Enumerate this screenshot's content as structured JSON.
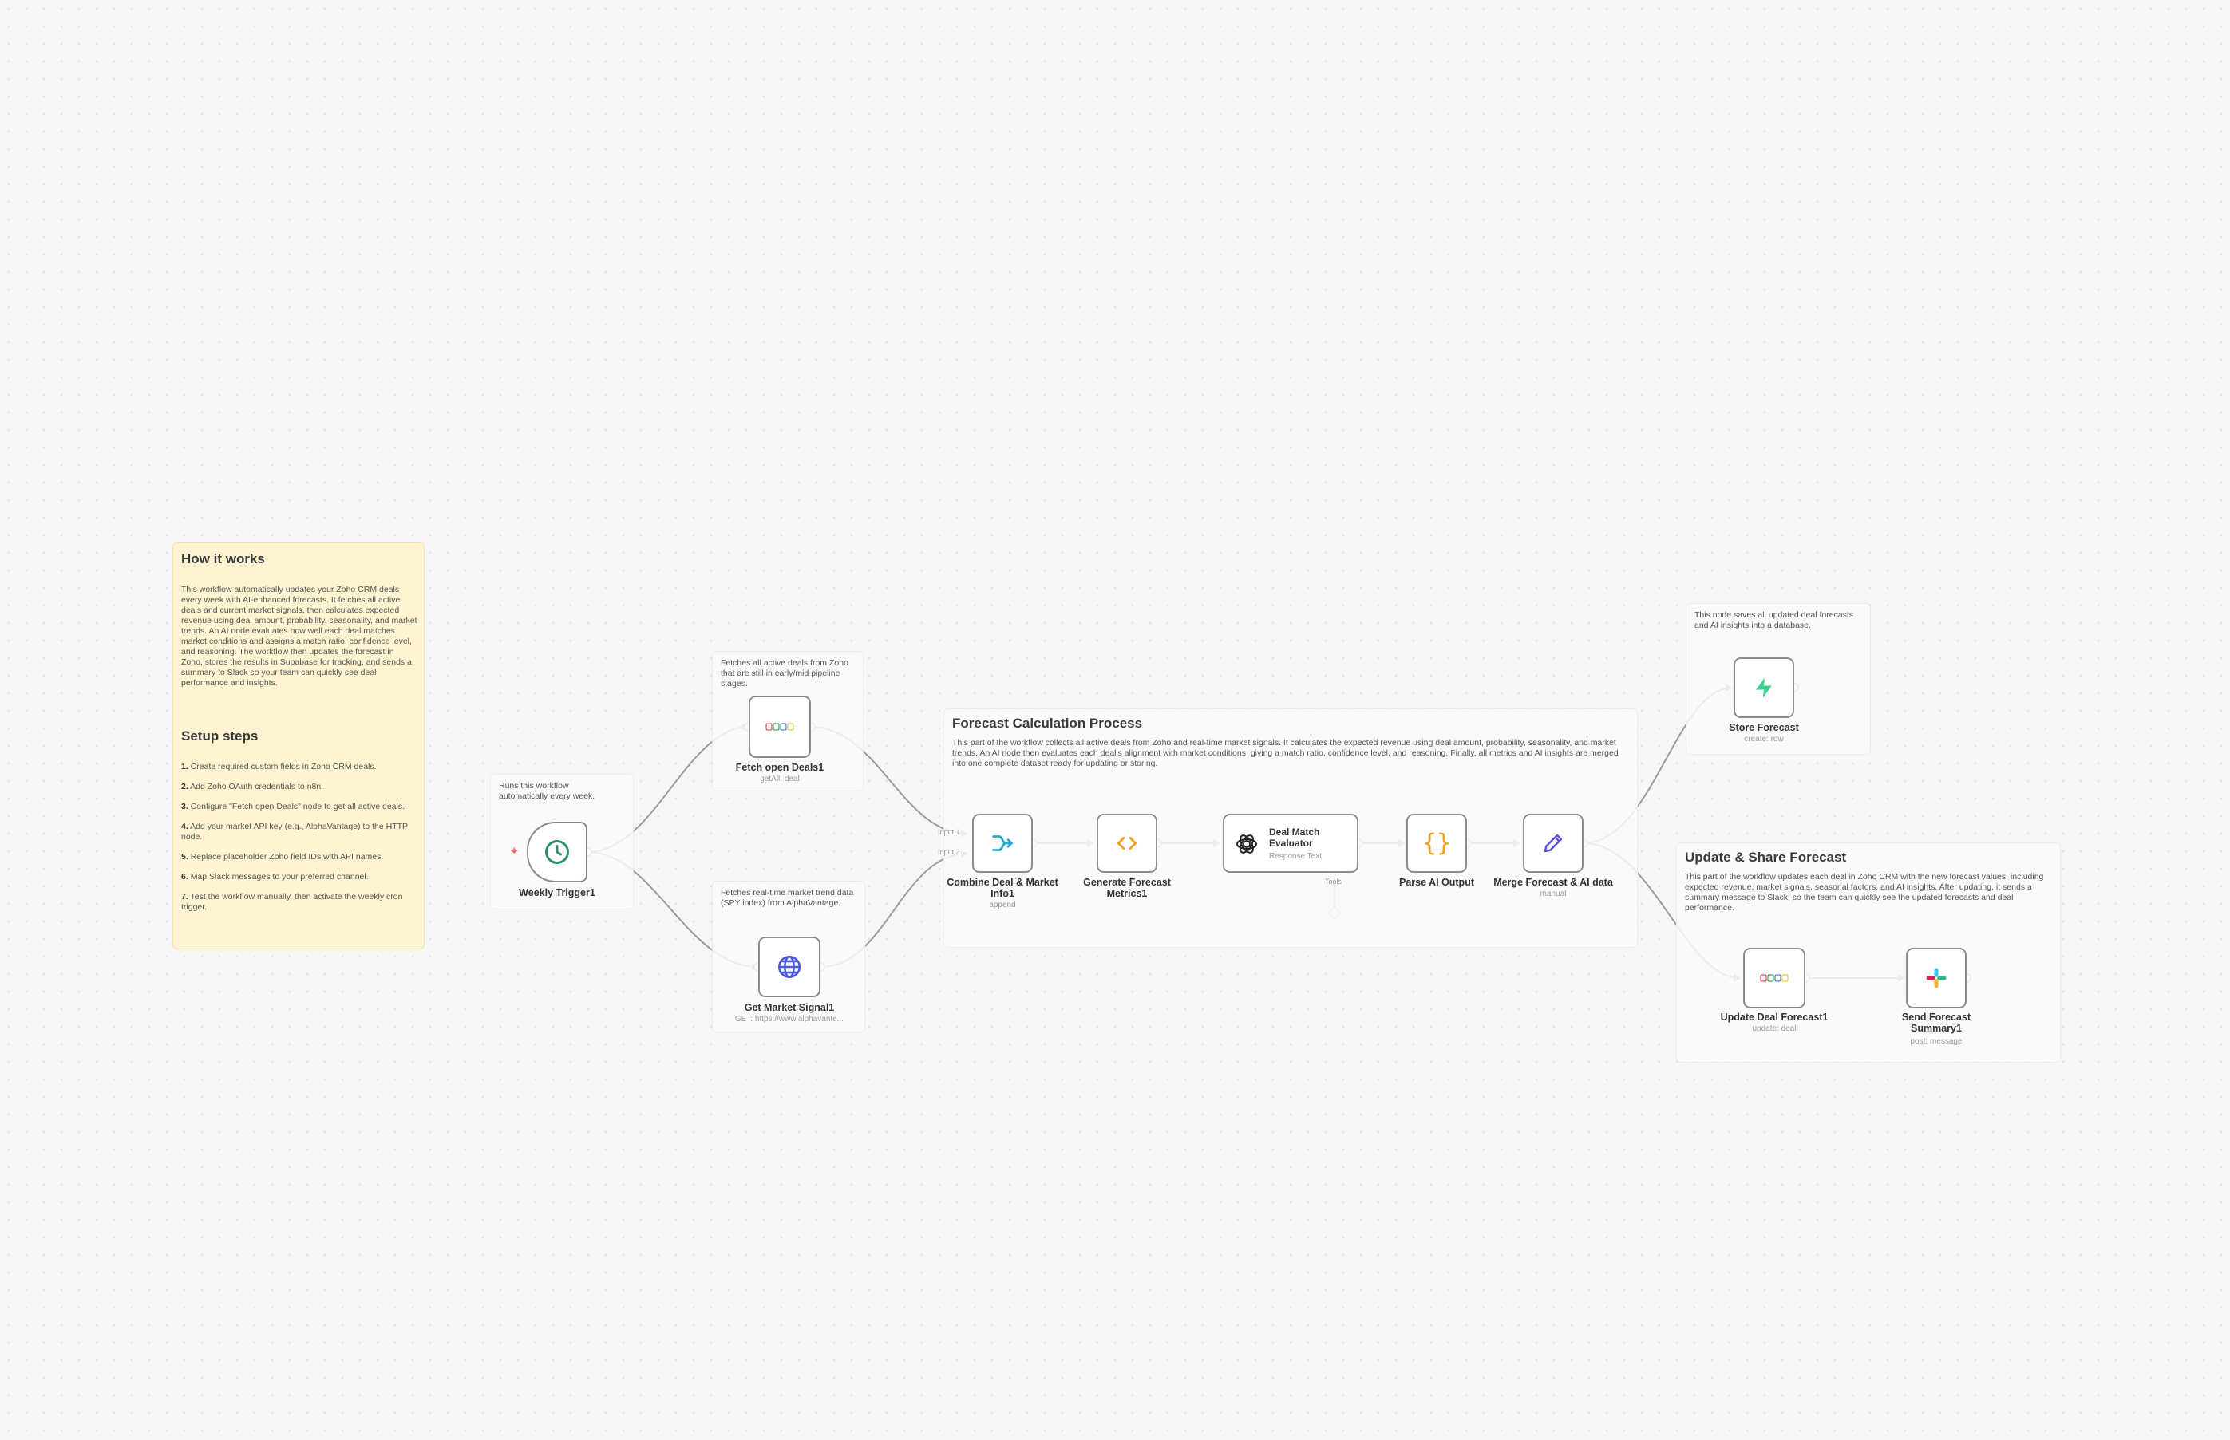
{
  "notes": {
    "how_it_works": {
      "title": "How it works",
      "body": "This workflow automatically updates your Zoho CRM deals every week with AI-enhanced forecasts. It fetches all active deals and current market signals, then calculates expected revenue using deal amount, probability, seasonality, and market trends. An AI node evaluates how well each deal matches market conditions and assigns a match ratio, confidence level, and reasoning. The workflow then updates the forecast in Zoho, stores the results in Supabase for tracking, and sends a summary to Slack so your team can quickly see deal performance and insights."
    },
    "setup": {
      "title": "Setup steps",
      "steps": [
        {
          "num": "1.",
          "text": "Create required custom fields in Zoho CRM deals."
        },
        {
          "num": "2.",
          "text": "Add Zoho OAuth credentials to n8n."
        },
        {
          "num": "3.",
          "text": "Configure \"Fetch open Deals\" node to get all active deals."
        },
        {
          "num": "4.",
          "text": "Add your market API key (e.g., AlphaVantage) to the HTTP node."
        },
        {
          "num": "5.",
          "text": "Replace placeholder Zoho field IDs with API names."
        },
        {
          "num": "6.",
          "text": "Map Slack messages to your preferred channel."
        },
        {
          "num": "7.",
          "text": "Test the workflow manually, then activate the weekly cron trigger."
        }
      ]
    },
    "trigger_note": "Runs this workflow automatically every week.",
    "fetch_note": "Fetches all active deals from Zoho that are still in early/mid pipeline stages.",
    "market_note": "Fetches real-time market trend data (SPY index) from AlphaVantage.",
    "forecast_section": {
      "title": "Forecast Calculation Process",
      "body": "This part of the workflow collects all active deals from Zoho and real-time market signals. It calculates the expected revenue using deal amount, probability, seasonality, and market trends. An AI node then evaluates each deal's alignment with market conditions, giving a match ratio, confidence level, and reasoning. Finally, all metrics and AI insights are merged into one complete dataset ready for updating or storing."
    },
    "store_note": "This node saves all updated deal forecasts and AI insights into a database.",
    "share_section": {
      "title": "Update & Share Forecast",
      "body": "This part of the workflow updates each deal in Zoho CRM with the new forecast values, including expected revenue, market signals, seasonal factors, and AI insights. After updating, it sends a summary message to Slack, so the team can quickly see the updated forecasts and deal performance."
    }
  },
  "nodes": {
    "weekly_trigger": {
      "label": "Weekly Trigger1",
      "icon": "clock-icon"
    },
    "fetch_deals": {
      "label": "Fetch open Deals1",
      "sub": "getAll: deal",
      "icon": "zoho-icon"
    },
    "market_signal": {
      "label": "Get Market Signal1",
      "sub": "GET: https://www.alphavante...",
      "icon": "globe-icon"
    },
    "combine": {
      "label": "Combine Deal & Market Info1",
      "sub": "append",
      "port1": "Input 1",
      "port2": "Input 2",
      "icon": "merge-icon"
    },
    "generate": {
      "label": "Generate Forecast Metrics1",
      "icon": "code-icon"
    },
    "evaluator": {
      "label": "Deal Match Evaluator",
      "sub": "Response Text",
      "tool_label": "Tools",
      "icon": "openai-icon"
    },
    "parse": {
      "label": "Parse AI Output",
      "icon": "braces-icon"
    },
    "merge": {
      "label": "Merge Forecast & AI data",
      "sub": "manual",
      "icon": "pen-icon"
    },
    "store": {
      "label": "Store Forecast",
      "sub": "create: row",
      "icon": "supabase-icon"
    },
    "update_deal": {
      "label": "Update Deal Forecast1",
      "sub": "update: deal",
      "icon": "zoho-icon"
    },
    "slack": {
      "label": "Send Forecast Summary1",
      "sub": "post: message",
      "icon": "slack-icon"
    }
  },
  "colors": {
    "canvas": "#f6f6f6",
    "sticky_yellow": "#fff4d2",
    "node_border": "#8c8c8c",
    "wire": "#9b9b9b",
    "trigger_accent": "#ff6d5a",
    "clock": "#2f8f6c",
    "code": "#f0a020",
    "pen": "#5a55d6",
    "supabase": "#3ecf8e",
    "globe": "#4b5bd6"
  }
}
